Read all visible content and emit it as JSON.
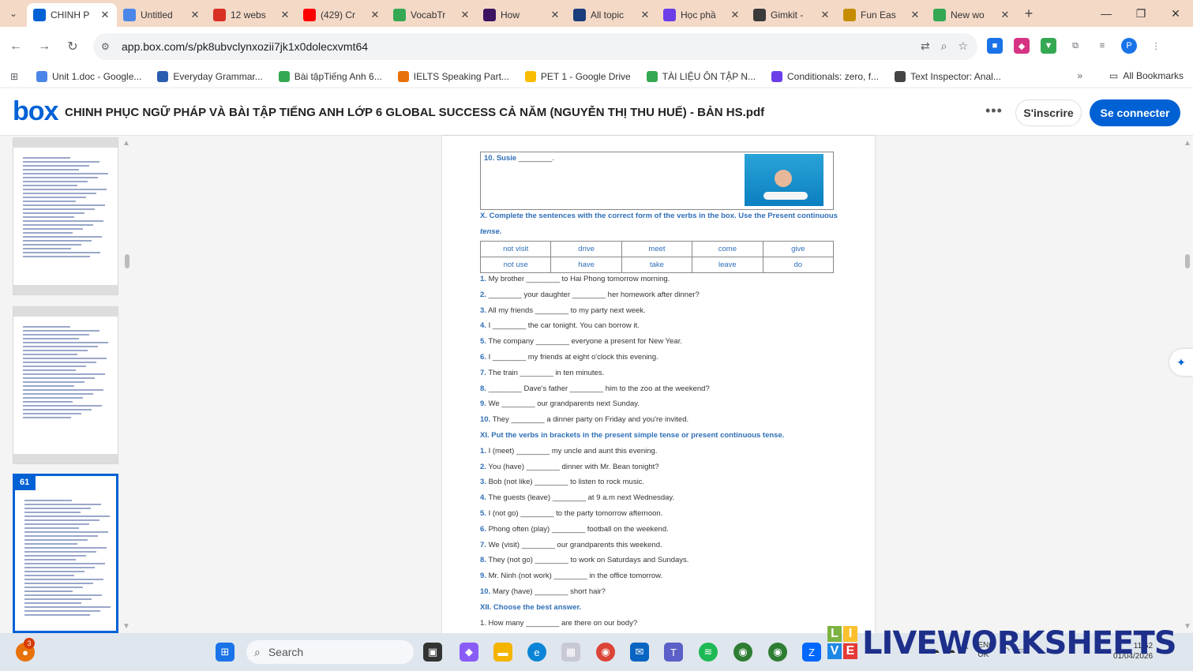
{
  "browser": {
    "tabs": [
      {
        "title": "CHINH P",
        "color": "#0061d5",
        "active": true
      },
      {
        "title": "Untitled",
        "color": "#4a86e8",
        "active": false
      },
      {
        "title": "12 webs",
        "color": "#d93025",
        "active": false
      },
      {
        "title": "(429) Cr",
        "color": "#ff0000",
        "active": false
      },
      {
        "title": "VocabTr",
        "color": "#34a853",
        "active": false
      },
      {
        "title": "How",
        "color": "#3c1361",
        "active": false
      },
      {
        "title": "All topic",
        "color": "#1a3d7c",
        "active": false
      },
      {
        "title": "Học phầ",
        "color": "#6a3de8",
        "active": false
      },
      {
        "title": "Gimkit -",
        "color": "#3a3a3a",
        "active": false
      },
      {
        "title": "Fun Eas",
        "color": "#c58c00",
        "active": false
      },
      {
        "title": "New wo",
        "color": "#34a853",
        "active": false
      }
    ],
    "new_tab": "+",
    "window_controls": {
      "minimize": "—",
      "restore": "❐",
      "close": "✕"
    },
    "url": "app.box.com/s/pk8ubvclynxozii7jk1x0dolecxvmt64",
    "bookmarks": [
      {
        "label": "Unit 1.doc - Google...",
        "color": "#4a86e8"
      },
      {
        "label": "Everyday Grammar...",
        "color": "#2a5db0"
      },
      {
        "label": "Bài tậpTiếng Anh 6...",
        "color": "#34a853"
      },
      {
        "label": "IELTS Speaking Part...",
        "color": "#e8710a"
      },
      {
        "label": "PET 1 - Google Drive",
        "color": "#fbbc04"
      },
      {
        "label": "TÀI LIỆU ÔN TẬP N...",
        "color": "#34a853"
      },
      {
        "label": "Conditionals: zero, f...",
        "color": "#6a3de8"
      },
      {
        "label": "Text Inspector: Anal...",
        "color": "#444444"
      }
    ],
    "bookmarks_more": "»",
    "all_bookmarks": "All Bookmarks"
  },
  "box": {
    "logo": "box",
    "title": "CHINH PHỤC NGỮ PHÁP VÀ BÀI TẬP TIẾNG ANH LỚP 6 GLOBAL SUCCESS CẢ NĂM (NGUYỄN THỊ THU HUẾ) - BẢN HS.pdf",
    "more": "•••",
    "signup": "S'inscrire",
    "login": "Se connecter",
    "accent": "#0061d5"
  },
  "viewer": {
    "active_page_number": "61",
    "page": {
      "item10_label": "10. Susie",
      "item10_blank": "________.",
      "section_x": "X. Complete the sentences with the correct form of the verbs in the box. Use the Present continuous",
      "section_x_cont": "tense.",
      "verb_box": [
        [
          "not visit",
          "drive",
          "meet",
          "come",
          "give"
        ],
        [
          "not use",
          "have",
          "take",
          "leave",
          "do"
        ]
      ],
      "section_x_items": [
        {
          "n": "1.",
          "t": "My brother ________ to Hai Phong tomorrow morning."
        },
        {
          "n": "2.",
          "t": "________ your daughter ________ her homework after dinner?"
        },
        {
          "n": "3.",
          "t": "All my friends ________ to my party next week."
        },
        {
          "n": "4.",
          "t": "I ________ the car tonight. You can borrow it."
        },
        {
          "n": "5.",
          "t": "The company ________ everyone a present for New Year."
        },
        {
          "n": "6.",
          "t": "I ________ my friends at eight o'clock this evening."
        },
        {
          "n": "7.",
          "t": "The train ________ in ten minutes."
        },
        {
          "n": "8.",
          "t": "________ Dave's father ________ him to the zoo at the weekend?"
        },
        {
          "n": "9.",
          "t": "We ________ our grandparents next Sunday."
        },
        {
          "n": "10.",
          "t": "They ________ a dinner party on Friday and you're invited."
        }
      ],
      "section_xi": "XI. Put the verbs in brackets in the present simple tense or present continuous tense.",
      "section_xi_items": [
        {
          "n": "1.",
          "t": "I (meet) ________ my uncle and aunt this evening."
        },
        {
          "n": "2.",
          "t": "You (have) ________ dinner with Mr. Bean tonight?"
        },
        {
          "n": "3.",
          "t": "Bob (not like) ________ to listen to rock music."
        },
        {
          "n": "4.",
          "t": "The guests (leave) ________ at 9 a.m next Wednesday."
        },
        {
          "n": "5.",
          "t": "I (not go) ________ to the party tomorrow afternoon."
        },
        {
          "n": "6.",
          "t": "Phong often (play) ________ football on the weekend."
        },
        {
          "n": "7.",
          "t": "We (visit) ________ our grandparents this weekend."
        },
        {
          "n": "8.",
          "t": "They (not go) ________ to work on Saturdays and Sundays."
        },
        {
          "n": "9.",
          "t": "Mr. Ninh (not work) ________ in the office tomorrow."
        },
        {
          "n": "10.",
          "t": "Mary (have) ________ short hair?"
        }
      ],
      "section_xii": "XII. Choose the best answer.",
      "section_xii_item1": "1. How many ________ are there on our body?"
    }
  },
  "taskbar": {
    "search_placeholder": "Search",
    "notification_count": "3",
    "lang_top": "ENG",
    "lang_bottom": "UK",
    "time": "11:52",
    "date": "01/04/2026"
  },
  "watermark": "LIVEWORKSHEETS"
}
